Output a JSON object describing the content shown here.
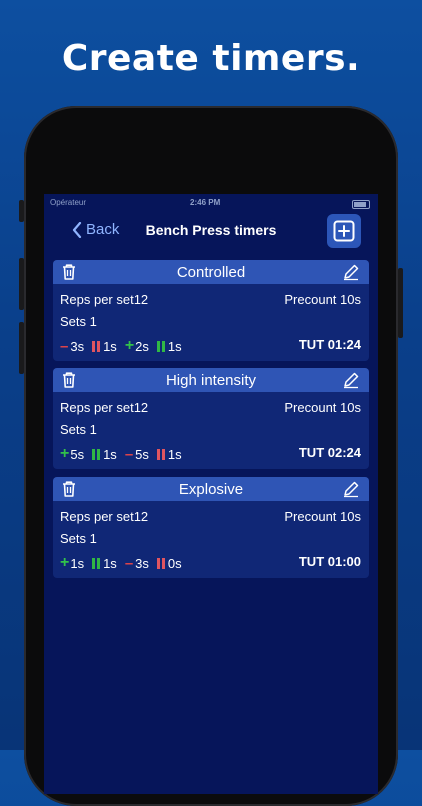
{
  "headline": "Create timers.",
  "status": {
    "carrier": "Opérateur",
    "time": "2:46 PM"
  },
  "nav": {
    "back_label": "Back",
    "title": "Bench Press timers"
  },
  "colors": {
    "minus": "#e0444a",
    "plus": "#32c24a",
    "pause_red": "#e05560",
    "pause_green": "#30b845"
  },
  "cards": [
    {
      "title": "Controlled",
      "reps": "Reps per set12",
      "precount": "Precount 10s",
      "sets": "Sets 1",
      "tut": "TUT 01:24",
      "steps": [
        {
          "type": "minus",
          "value": "3s"
        },
        {
          "type": "pause-red",
          "value": "1s"
        },
        {
          "type": "plus",
          "value": "2s"
        },
        {
          "type": "pause-green",
          "value": "1s"
        }
      ]
    },
    {
      "title": "High intensity",
      "reps": "Reps per set12",
      "precount": "Precount 10s",
      "sets": "Sets 1",
      "tut": "TUT 02:24",
      "steps": [
        {
          "type": "plus",
          "value": "5s"
        },
        {
          "type": "pause-green",
          "value": "1s"
        },
        {
          "type": "minus",
          "value": "5s"
        },
        {
          "type": "pause-red",
          "value": "1s"
        }
      ]
    },
    {
      "title": "Explosive",
      "reps": "Reps per set12",
      "precount": "Precount 10s",
      "sets": "Sets 1",
      "tut": "TUT 01:00",
      "steps": [
        {
          "type": "plus",
          "value": "1s"
        },
        {
          "type": "pause-green",
          "value": "1s"
        },
        {
          "type": "minus",
          "value": "3s"
        },
        {
          "type": "pause-red",
          "value": "0s"
        }
      ]
    }
  ]
}
